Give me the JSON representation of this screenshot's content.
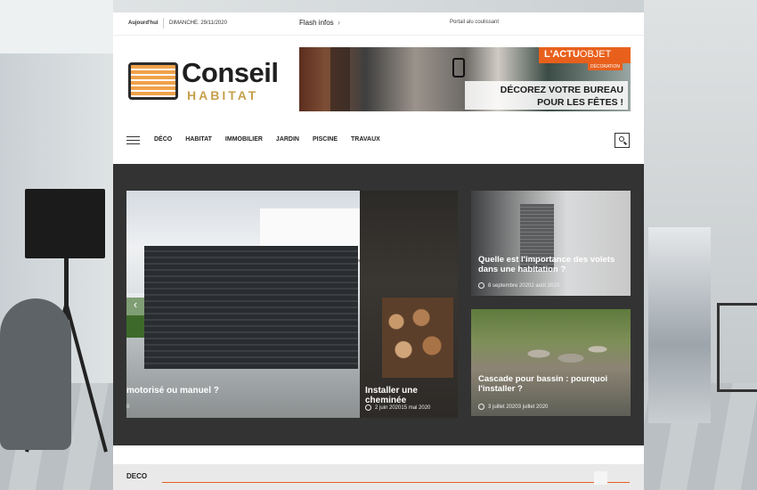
{
  "topbar": {
    "today_label": "Aujourd'hui",
    "date": "DIMANCHE. 29/11/2020",
    "flash_label": "Flash infos",
    "flash_item": "Portail alu coulissant"
  },
  "logo": {
    "main": "Conseil",
    "sub": "HABITAT"
  },
  "banner": {
    "brand_bold": "L'ACTU",
    "brand_light": "OBJET",
    "tag": "DÉCORATION",
    "line1": "DÉCOREZ VOTRE BUREAU",
    "line2": "POUR LES FÊTES !"
  },
  "nav": {
    "items": [
      "DÉCO",
      "HABITAT",
      "IMMOBILIER",
      "JARDIN",
      "PISCINE",
      "TRAVAUX"
    ]
  },
  "featured": {
    "gate": {
      "title": "motorisé ou manuel ?",
      "meta": "0"
    },
    "fire": {
      "title": "Installer une cheminée",
      "meta": "2 juin 202015 mai 2020"
    },
    "volets": {
      "title": "Quelle est l'importance des volets dans une habitation ?",
      "meta": "8 septembre 20202 août 2020"
    },
    "cascade": {
      "title": "Cascade pour bassin : pourquoi l'installer ?",
      "meta": "3 juillet 20203 juillet 2020"
    }
  },
  "section": {
    "title": "DECO"
  },
  "colors": {
    "accent": "#e8601c",
    "logo_gold": "#c7a04d",
    "featured_bg": "#333333"
  }
}
